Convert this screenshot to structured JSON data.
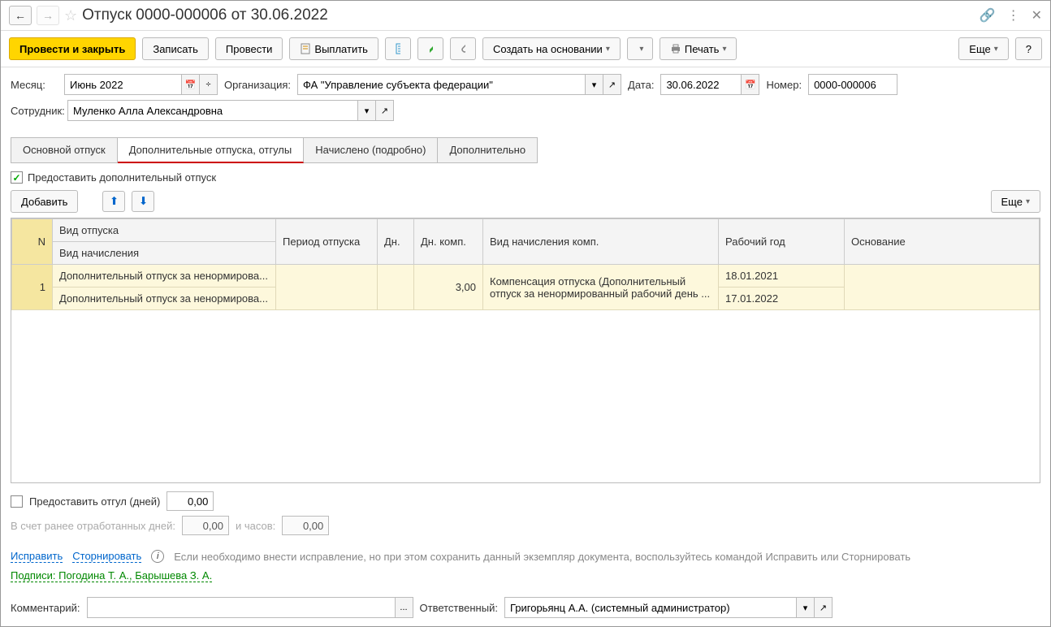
{
  "title": "Отпуск 0000-000006 от 30.06.2022",
  "toolbar": {
    "post_close": "Провести и закрыть",
    "write": "Записать",
    "post": "Провести",
    "pay": "Выплатить",
    "create_based": "Создать на основании",
    "print": "Печать",
    "more": "Еще",
    "help": "?"
  },
  "form": {
    "month_lbl": "Месяц:",
    "month_val": "Июнь 2022",
    "org_lbl": "Организация:",
    "org_val": "ФА \"Управление субъекта федерации\"",
    "date_lbl": "Дата:",
    "date_val": "30.06.2022",
    "number_lbl": "Номер:",
    "number_val": "0000-000006",
    "emp_lbl": "Сотрудник:",
    "emp_val": "Муленко Алла Александровна"
  },
  "tabs": {
    "t1": "Основной отпуск",
    "t2": "Дополнительные отпуска, отгулы",
    "t3": "Начислено (подробно)",
    "t4": "Дополнительно"
  },
  "content": {
    "grant_chk": "Предоставить дополнительный отпуск",
    "add_btn": "Добавить",
    "more_btn": "Еще",
    "headers": {
      "n": "N",
      "type": "Вид отпуска",
      "type2": "Вид начисления",
      "period": "Период отпуска",
      "days": "Дн.",
      "days_comp": "Дн. комп.",
      "accrual": "Вид начисления комп.",
      "year": "Рабочий год",
      "basis": "Основание"
    },
    "row": {
      "n": "1",
      "type1": "Дополнительный отпуск за ненормирова...",
      "type2": "Дополнительный отпуск за ненормирова...",
      "days_comp": "3,00",
      "accrual": "Компенсация отпуска (Дополнительный отпуск за ненормированный рабочий день ...",
      "year1": "18.01.2021",
      "year2": "17.01.2022"
    },
    "otgul_lbl": "Предоставить отгул (дней)",
    "otgul_val": "0,00",
    "worked_days_lbl": "В счет ранее отработанных дней:",
    "worked_days_val": "0,00",
    "hours_lbl": "и часов:",
    "hours_val": "0,00"
  },
  "links": {
    "fix": "Исправить",
    "reverse": "Сторнировать",
    "info": "Если необходимо внести исправление, но при этом сохранить данный экземпляр документа, воспользуйтесь командой Исправить или Сторнировать",
    "sign": "Подписи: Погодина Т. А., Барышева З. А."
  },
  "footer": {
    "comment_lbl": "Комментарий:",
    "comment_val": "",
    "resp_lbl": "Ответственный:",
    "resp_val": "Григорьянц А.А. (системный администратор)"
  }
}
